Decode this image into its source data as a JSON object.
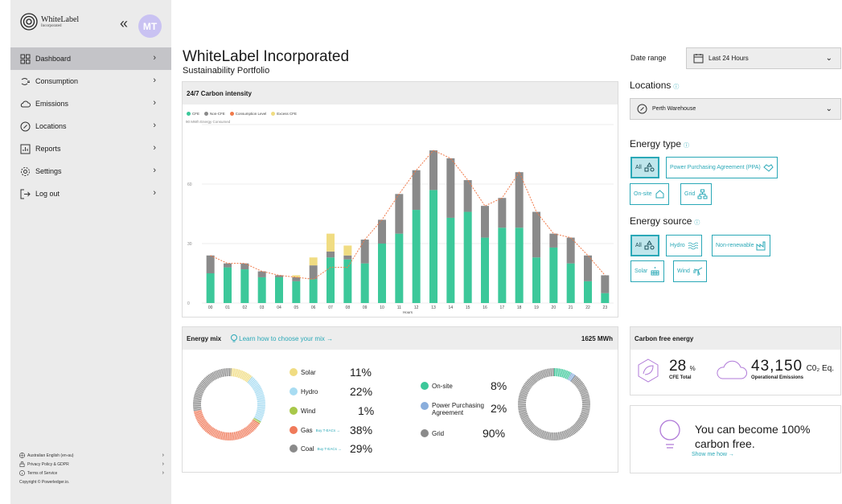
{
  "brand": {
    "name": "WhiteLabel",
    "sub": "Incorporated"
  },
  "avatar": "MT",
  "collapse": "«",
  "nav": [
    {
      "label": "Dashboard",
      "icon": "dashboard-icon",
      "active": true
    },
    {
      "label": "Consumption",
      "icon": "plug-icon"
    },
    {
      "label": "Emissions",
      "icon": "cloud-icon"
    },
    {
      "label": "Locations",
      "icon": "compass-icon"
    },
    {
      "label": "Reports",
      "icon": "report-icon"
    },
    {
      "label": "Settings",
      "icon": "gear-icon"
    },
    {
      "label": "Log out",
      "icon": "logout-icon"
    }
  ],
  "footer": {
    "language": "Australian English (en-au)",
    "privacy": "Privacy Policy & GDPR",
    "terms": "Terms of Service",
    "copyright": "Copyright © Powerledger.io."
  },
  "header": {
    "title": "WhiteLabel Incorporated",
    "subtitle": "Sustainability Portfolio"
  },
  "carbon_card": {
    "title": "24/7 Carbon intensity",
    "legend": [
      "CFE",
      "Non-CFE",
      "Consumption Level",
      "Excess CFE"
    ],
    "colors": {
      "cfe": "#3cc89a",
      "noncfe": "#8a8a8a",
      "consumption": "#f07a4a",
      "excess": "#f0dc82"
    }
  },
  "chart_data": {
    "type": "bar",
    "ylabel": "90 MWh Energy Consumed",
    "xlabel": "Hours",
    "ylim": [
      0,
      90
    ],
    "yticks": [
      "0",
      "30",
      "60"
    ],
    "categories": [
      "00",
      "01",
      "02",
      "03",
      "04",
      "05",
      "06",
      "07",
      "08",
      "09",
      "10",
      "11",
      "12",
      "13",
      "14",
      "15",
      "16",
      "17",
      "18",
      "19",
      "20",
      "21",
      "22",
      "23"
    ],
    "series": [
      {
        "name": "CFE",
        "values": [
          15,
          18,
          17,
          13,
          13,
          11,
          12,
          23,
          22,
          20,
          30,
          35,
          47,
          57,
          43,
          46,
          33,
          38,
          38,
          23,
          28,
          20,
          11,
          5
        ]
      },
      {
        "name": "Non-CFE",
        "values": [
          9,
          2,
          3,
          3,
          1,
          2,
          7,
          3,
          2,
          12,
          12,
          20,
          20,
          20,
          30,
          16,
          16,
          15,
          28,
          23,
          7,
          13,
          13,
          9
        ]
      },
      {
        "name": "Excess CFE",
        "values": [
          0,
          0,
          0,
          0,
          0,
          1,
          4,
          9,
          5,
          0,
          0,
          0,
          0,
          0,
          0,
          0,
          0,
          0,
          0,
          0,
          0,
          0,
          0,
          0
        ]
      },
      {
        "name": "Consumption Level",
        "values": [
          24,
          20,
          20,
          16,
          14,
          13,
          12,
          18,
          18,
          32,
          42,
          55,
          67,
          77,
          73,
          62,
          49,
          53,
          66,
          46,
          35,
          33,
          24,
          14
        ]
      }
    ]
  },
  "mix": {
    "title": "Energy mix",
    "learn": "Learn how to choose your mix →",
    "total": "1625 MWh",
    "sources": [
      {
        "label": "Solar",
        "pct": "11%",
        "color": "#f0dc82"
      },
      {
        "label": "Hydro",
        "pct": "22%",
        "color": "#a8dcf2"
      },
      {
        "label": "Wind",
        "pct": "1%",
        "color": "#a8c84a"
      },
      {
        "label": "Gas",
        "pct": "38%",
        "color": "#f07a5a",
        "buy": "Buy T-EACs →"
      },
      {
        "label": "Coal",
        "pct": "29%",
        "color": "#8a8a8a",
        "buy": "Buy T-EACs →"
      }
    ],
    "types": [
      {
        "label": "On-site",
        "pct": "8%",
        "color": "#3cc89a"
      },
      {
        "label": "Power Purchasing Agreement",
        "pct": "2%",
        "color": "#8aaedc"
      },
      {
        "label": "Grid",
        "pct": "90%",
        "color": "#8a8a8a"
      }
    ]
  },
  "date_range": {
    "label": "Date range",
    "value": "Last 24 Hours"
  },
  "locations": {
    "title": "Locations",
    "value": "Perth Warehouse"
  },
  "energy_type": {
    "title": "Energy type",
    "chips": [
      "All",
      "Power Purchasing Agreement (PPA)",
      "On-site",
      "Grid"
    ]
  },
  "energy_source": {
    "title": "Energy source",
    "chips": [
      "All",
      "Hydro",
      "Non-renewable",
      "Solar",
      "Wind"
    ]
  },
  "cfe": {
    "title": "Carbon free energy",
    "pct_value": "28",
    "pct_unit": "%",
    "pct_label": "CFE Total",
    "emis_value": "43,150",
    "emis_unit": "C0₂ Eq.",
    "emis_label": "Operational Emissions"
  },
  "promo": {
    "text": "You can become 100% carbon free.",
    "link": "Show me how →"
  },
  "info_glyph": "ⓘ"
}
